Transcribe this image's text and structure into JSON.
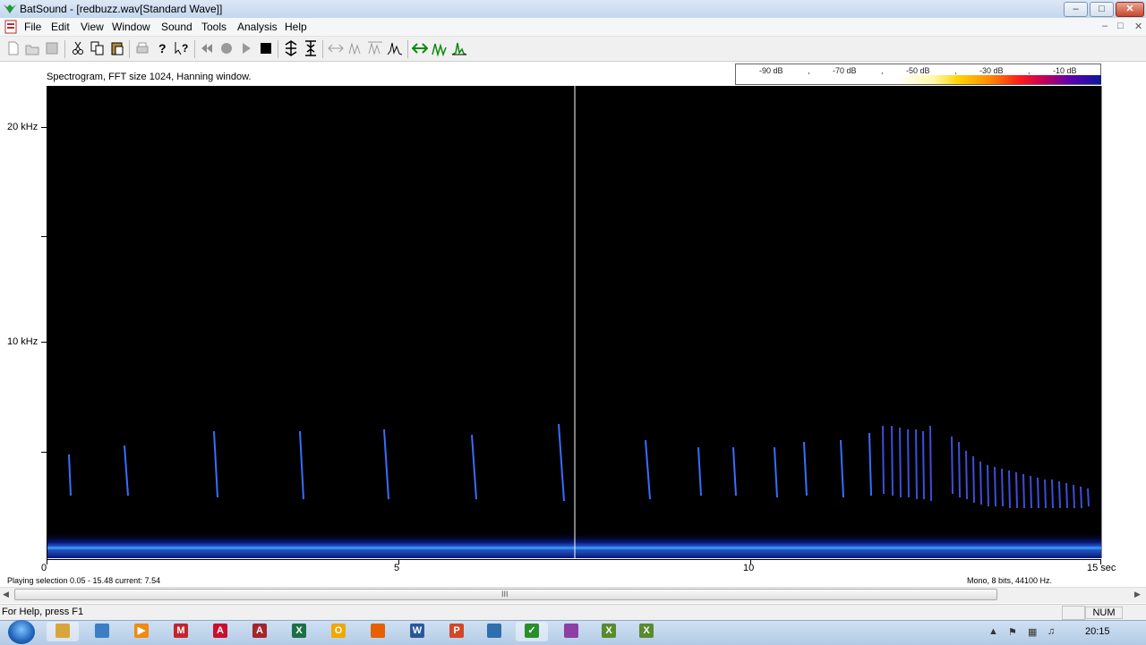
{
  "window": {
    "title": "BatSound - [redbuzz.wav[Standard Wave]]",
    "min_label": "–",
    "max_label": "□",
    "close_label": "✕"
  },
  "menu": [
    "File",
    "Edit",
    "View",
    "Window",
    "Sound",
    "Tools",
    "Analysis",
    "Help"
  ],
  "mdi_controls": [
    "–",
    "□",
    "✕"
  ],
  "toolbar_icons": [
    "new-icon",
    "open-icon",
    "save-icon",
    "cut-icon",
    "copy-icon",
    "paste-icon",
    "print-icon",
    "help-icon",
    "context-help-icon",
    "rewind-icon",
    "record-icon",
    "play-icon",
    "stop-icon",
    "zoom-in-vertical-icon",
    "zoom-out-vertical-icon",
    "zoom-horizontal-icon",
    "zoom-fit-icon",
    "zoom-sel-icon",
    "spectrum-icon",
    "marker-icon",
    "pulse-icon",
    "peak-icon"
  ],
  "spectrogram": {
    "title": "Spectrogram, FFT size 1024, Hanning window.",
    "y_labels": [
      "20 kHz",
      "10 kHz"
    ],
    "x_labels": [
      "0",
      "5",
      "10",
      "15 sec"
    ],
    "colorscale_labels": [
      "-90 dB",
      ",",
      "-70 dB",
      ",",
      "-50 dB",
      ",",
      "-30 dB",
      ",",
      "-10 dB"
    ],
    "cursor_time_sec": 7.54
  },
  "status": {
    "selection": "Playing selection 0.05 - 15.48  current: 7.54",
    "format": "Mono, 8 bits, 44100 Hz.",
    "help": "For Help, press F1",
    "num": "NUM",
    "scroll_grip": "III"
  },
  "taskbar": {
    "clock": "20:15",
    "items": [
      {
        "name": "explorer",
        "color": "#d9a53a",
        "glyph": ""
      },
      {
        "name": "media",
        "color": "#3b7ec6",
        "glyph": ""
      },
      {
        "name": "player",
        "color": "#f08a12",
        "glyph": "▶"
      },
      {
        "name": "app-m",
        "color": "#c0262c",
        "glyph": "M"
      },
      {
        "name": "acrobat",
        "color": "#c8102e",
        "glyph": "A"
      },
      {
        "name": "access",
        "color": "#a4262c",
        "glyph": "A"
      },
      {
        "name": "excel",
        "color": "#1d7044",
        "glyph": "X"
      },
      {
        "name": "outlook",
        "color": "#f0a800",
        "glyph": "O"
      },
      {
        "name": "firefox",
        "color": "#e66000",
        "glyph": ""
      },
      {
        "name": "word",
        "color": "#2b579a",
        "glyph": "W"
      },
      {
        "name": "powerpoint",
        "color": "#d24726",
        "glyph": "P"
      },
      {
        "name": "monitor",
        "color": "#2f6fae",
        "glyph": ""
      },
      {
        "name": "batsound",
        "color": "#2a8f2a",
        "glyph": "✓"
      },
      {
        "name": "paint",
        "color": "#8e3fa3",
        "glyph": ""
      },
      {
        "name": "xls-a",
        "color": "#5a8a2e",
        "glyph": "X"
      },
      {
        "name": "xls-b",
        "color": "#5a8a2e",
        "glyph": "X"
      }
    ]
  }
}
